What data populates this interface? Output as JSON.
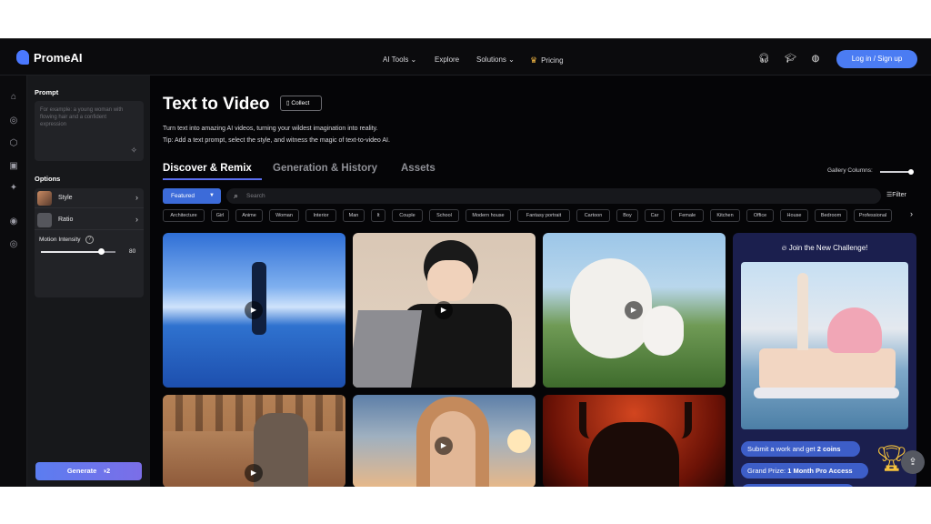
{
  "brand": {
    "name": "PromeAI"
  },
  "nav": {
    "ai_tools": "AI Tools",
    "explore": "Explore",
    "solutions": "Solutions",
    "pricing": "Pricing",
    "login": "Log in / Sign up"
  },
  "panel": {
    "prompt_label": "Prompt",
    "prompt_placeholder": "For example: a young woman with flowing hair and a confident expression",
    "options_label": "Options",
    "style_label": "Style",
    "ratio_label": "Ratio",
    "motion_label": "Motion Intensity",
    "motion_value": "80",
    "motion_fraction": 0.8,
    "generate_label": "Generate",
    "generate_cost": "2"
  },
  "page": {
    "title": "Text to Video",
    "collect": "Collect",
    "description": "Turn text into amazing AI videos, turning your wildest imagination into reality.",
    "tip": "Tip: Add a text prompt, select the style, and witness the magic of text-to-video AI."
  },
  "tabs": [
    "Discover & Remix",
    "Generation & History",
    "Assets"
  ],
  "gallery_columns_label": "Gallery Columns:",
  "filter_bar": {
    "featured": "Featured",
    "search_placeholder": "Search",
    "filter": "Filter"
  },
  "chips": [
    "Architecture",
    "Girl",
    "Anime",
    "Woman",
    "Interior",
    "Man",
    "It",
    "Couple",
    "School",
    "Modern house",
    "Fantasy portrait",
    "Cartoon",
    "Boy",
    "Car",
    "Female",
    "Kitchen",
    "Office",
    "House",
    "Bedroom",
    "Professional"
  ],
  "challenge": {
    "title": "Join the New Challenge!",
    "submit": "Submit a work and get ",
    "submit_bold": "2 coins",
    "prize": "Grand Prize: ",
    "prize_bold": "1 Month Pro Access"
  },
  "colors": {
    "accent": "#4b7cf3",
    "challenge_bg": "#1b1f4e",
    "pill": "#3d5ec8"
  }
}
